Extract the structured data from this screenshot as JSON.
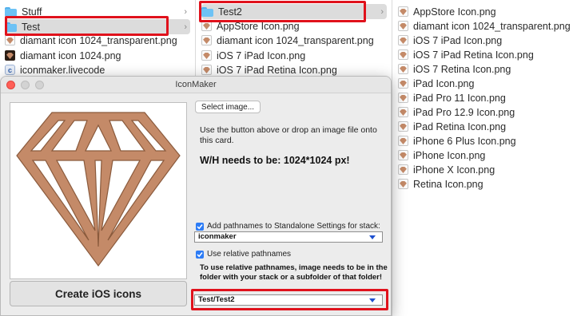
{
  "finder": {
    "col1": {
      "items": [
        {
          "label": "Stuff",
          "icon": "folder-icon"
        },
        {
          "label": "Test",
          "icon": "folder-icon",
          "selected": true
        },
        {
          "label": "diamant icon 1024_transparent.png",
          "icon": "png-file-icon"
        },
        {
          "label": "diamant icon 1024.png",
          "icon": "dark-image-file-icon"
        },
        {
          "label": "iconmaker.livecode",
          "icon": "livecode-file-icon"
        }
      ]
    },
    "col2": {
      "items": [
        {
          "label": "Test2",
          "icon": "folder-icon",
          "selected": true
        },
        {
          "label": "AppStore Icon.png",
          "icon": "png-file-icon"
        },
        {
          "label": "diamant icon 1024_transparent.png",
          "icon": "png-file-icon"
        },
        {
          "label": "iOS 7 iPad Icon.png",
          "icon": "png-file-icon"
        },
        {
          "label": "iOS 7 iPad Retina Icon.png",
          "icon": "png-file-icon"
        }
      ]
    },
    "col3": {
      "items": [
        {
          "label": "AppStore Icon.png"
        },
        {
          "label": "diamant icon 1024_transparent.png"
        },
        {
          "label": "iOS 7 iPad Icon.png"
        },
        {
          "label": "iOS 7 iPad Retina Icon.png"
        },
        {
          "label": "iOS 7 Retina Icon.png"
        },
        {
          "label": "iPad Icon.png"
        },
        {
          "label": "iPad Pro 11 Icon.png"
        },
        {
          "label": "iPad Pro 12.9 Icon.png"
        },
        {
          "label": "iPad Retina Icon.png"
        },
        {
          "label": "iPhone 6 Plus Icon.png"
        },
        {
          "label": "iPhone Icon.png"
        },
        {
          "label": "iPhone X Icon.png"
        },
        {
          "label": "Retina Icon.png"
        }
      ]
    }
  },
  "window": {
    "title": "IconMaker",
    "select_button": "Select image...",
    "instructions": "Use the button above or drop an image file onto this card.",
    "requirement": "W/H needs to be: 1024*1024 px!",
    "create_button": "Create iOS icons",
    "checkbox_standalone": {
      "label": "Add pathnames to Standalone Settings for stack:",
      "checked": true
    },
    "stack_dropdown": {
      "value": "iconmaker"
    },
    "checkbox_relative": {
      "label": "Use relative pathnames",
      "checked": true
    },
    "relative_note": "To use relative pathnames, image needs to be in the folder with your stack or a subfolder of that folder!",
    "folder_dropdown": {
      "value": "Test/Test2"
    }
  },
  "colors": {
    "highlight_box": "#e0121c",
    "folder": "#6dc2f5",
    "diamond_fill": "#c48a68",
    "diamond_stroke": "#8a5a3c",
    "checkbox": "#2d7cf6"
  }
}
